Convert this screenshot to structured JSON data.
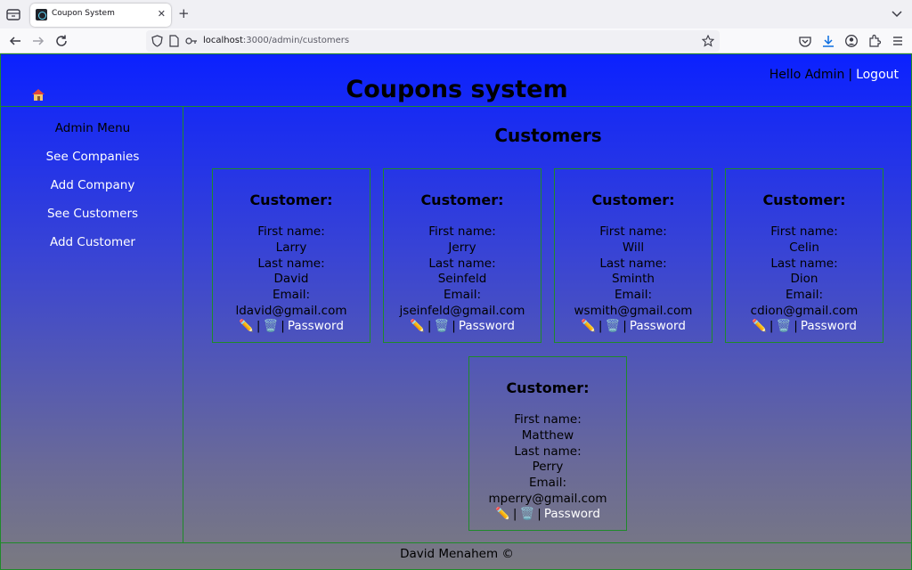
{
  "browser": {
    "tab_title": "Coupon System",
    "url_host": "localhost",
    "url_rest": ":3000/admin/customers"
  },
  "header": {
    "title": "Coupons system",
    "greeting": "Hello Admin",
    "separator": "|",
    "logout_label": "Logout"
  },
  "sidebar": {
    "title": "Admin Menu",
    "items": [
      {
        "label": "See Companies"
      },
      {
        "label": "Add Company"
      },
      {
        "label": "See Customers"
      },
      {
        "label": "Add Customer"
      }
    ]
  },
  "main": {
    "title": "Customers",
    "customers": [
      {
        "heading": "Customer:",
        "first_name_label": "First name:",
        "first_name": "Larry",
        "last_name_label": "Last name:",
        "last_name": "David",
        "email_label": "Email:",
        "email": "ldavid@gmail.com",
        "edit_icon": "✏️",
        "delete_icon": "🗑️",
        "password_label": "Password"
      },
      {
        "heading": "Customer:",
        "first_name_label": "First name:",
        "first_name": "Jerry",
        "last_name_label": "Last name:",
        "last_name": "Seinfeld",
        "email_label": "Email:",
        "email": "jseinfeld@gmail.com",
        "edit_icon": "✏️",
        "delete_icon": "🗑️",
        "password_label": "Password"
      },
      {
        "heading": "Customer:",
        "first_name_label": "First name:",
        "first_name": "Will",
        "last_name_label": "Last name:",
        "last_name": "Sminth",
        "email_label": "Email:",
        "email": "wsmith@gmail.com",
        "edit_icon": "✏️",
        "delete_icon": "🗑️",
        "password_label": "Password"
      },
      {
        "heading": "Customer:",
        "first_name_label": "First name:",
        "first_name": "Celin",
        "last_name_label": "Last name:",
        "last_name": "Dion",
        "email_label": "Email:",
        "email": "cdion@gmail.com",
        "edit_icon": "✏️",
        "delete_icon": "🗑️",
        "password_label": "Password"
      },
      {
        "heading": "Customer:",
        "first_name_label": "First name:",
        "first_name": "Matthew",
        "last_name_label": "Last name:",
        "last_name": "Perry",
        "email_label": "Email:",
        "email": "mperry@gmail.com",
        "edit_icon": "✏️",
        "delete_icon": "🗑️",
        "password_label": "Password"
      }
    ]
  },
  "footer": {
    "text": "David Menahem ©"
  },
  "colors": {
    "border": "#1f8a2a",
    "gradient_top": "#0b21ff",
    "gradient_bottom": "#7a7a80",
    "link": "#ffffff"
  }
}
